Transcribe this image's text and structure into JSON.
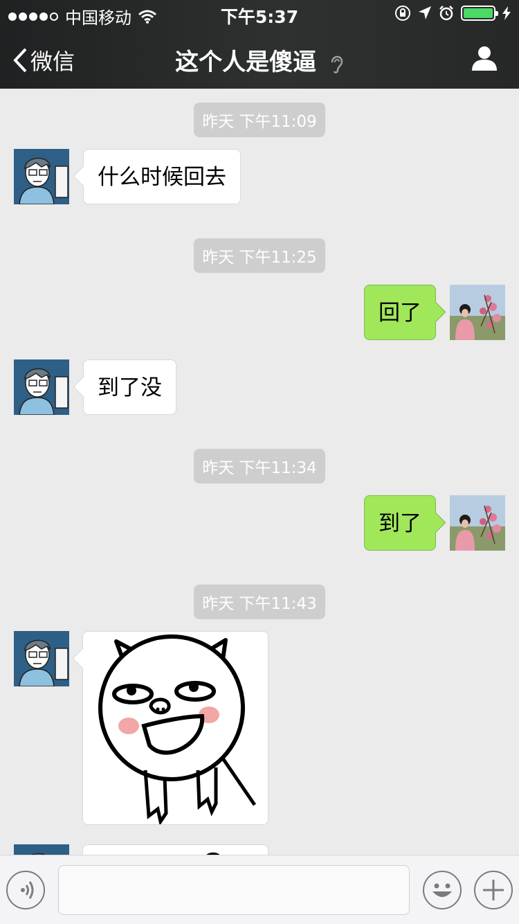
{
  "status_bar": {
    "carrier": "中国移动",
    "time": "下午5:37",
    "battery_level": 1.0
  },
  "nav": {
    "back_label": "微信",
    "title": "这个人是傻逼"
  },
  "messages": [
    {
      "timestamp": "昨天 下午11:09",
      "sender": "other",
      "text": "什么时候回去"
    },
    {
      "timestamp": "昨天 下午11:25",
      "sender": "self",
      "text": "回了"
    },
    {
      "sender": "other",
      "text": "到了没"
    },
    {
      "timestamp": "昨天 下午11:34",
      "sender": "self",
      "text": "到了"
    },
    {
      "timestamp": "昨天 下午11:43",
      "sender": "other",
      "type": "sticker"
    }
  ],
  "input": {
    "value": "",
    "placeholder": ""
  },
  "colors": {
    "nav_bg": "#2b2d2d",
    "chat_bg": "#ebebeb",
    "self_bubble": "#a0e75a",
    "other_bubble": "#ffffff",
    "timestamp_bg": "#cecece",
    "battery": "#4cd964"
  },
  "icons": [
    "signal-dots-icon",
    "wifi-icon",
    "rotation-lock-icon",
    "location-icon",
    "alarm-icon",
    "battery-icon",
    "charging-icon",
    "back-chevron-icon",
    "ear-icon",
    "profile-icon",
    "voice-icon",
    "emoji-icon",
    "plus-icon"
  ]
}
